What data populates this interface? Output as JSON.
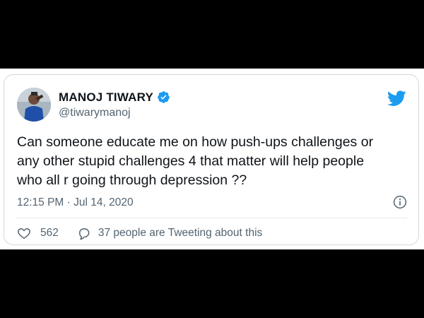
{
  "tweet": {
    "display_name": "MANOJ TIWARY",
    "handle": "@tiwarymanoj",
    "text_lines": [
      "Can someone educate me on how push-ups challenges or",
      "any other stupid challenges 4 that matter will help people",
      "who all r going through depression ??"
    ],
    "timestamp": "12:15 PM · Jul 14, 2020",
    "likes": "562",
    "discussion": "37 people are Tweeting about this"
  },
  "icons": {
    "verified": "verified-badge-icon",
    "logo": "twitter-bird-icon",
    "info": "info-icon",
    "like": "heart-icon",
    "reply": "speech-bubble-icon"
  },
  "colors": {
    "twitter_blue": "#1d9bf0",
    "text": "#0f1419",
    "secondary_text": "#536471",
    "border": "#cfd9de"
  }
}
